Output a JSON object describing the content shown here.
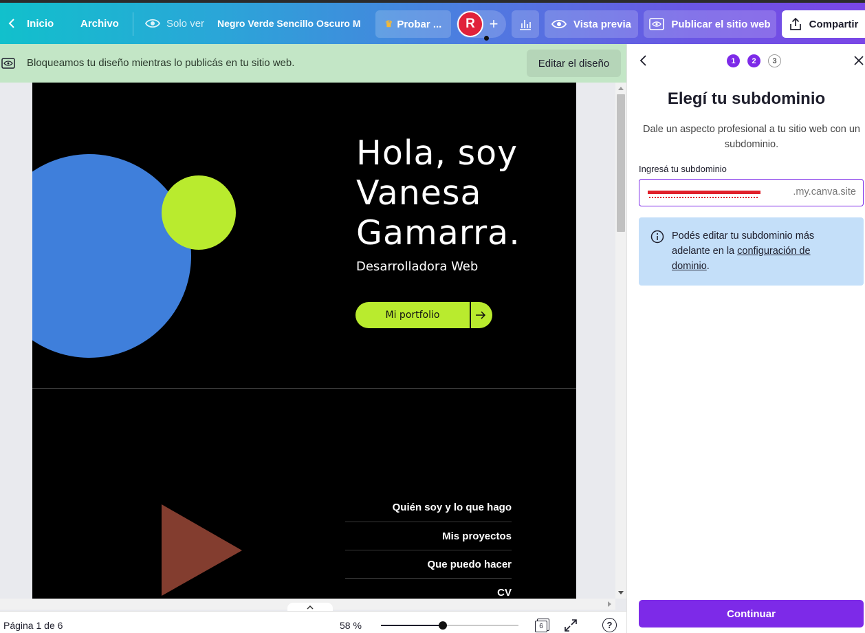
{
  "topbar": {
    "home_label": "Inicio",
    "file_label": "Archivo",
    "view_mode_label": "Solo ver",
    "doc_title": "Negro Verde Sencillo Oscuro M",
    "try_pro_label": "Probar ...",
    "avatar_initial": "R",
    "add_label": "+",
    "preview_label": "Vista previa",
    "publish_label": "Publicar el sitio web",
    "share_label": "Compartir"
  },
  "banner": {
    "message": "Bloqueamos tu diseño mientras lo publicás en tu sitio web.",
    "edit_button": "Editar el diseño"
  },
  "design": {
    "heading_line1": "Hola, soy",
    "heading_line2": "Vanesa",
    "heading_line3": "Gamarra.",
    "subtitle": "Desarrolladora Web",
    "portfolio_button": "Mi portfolio",
    "nav_items": [
      "Quién soy y lo que hago",
      "Mis proyectos",
      "Que puedo hacer",
      "CV"
    ],
    "colors": {
      "blue_circle": "#3f7fdb",
      "lime": "#b9eb2e",
      "triangle": "#833d2f"
    }
  },
  "panel": {
    "steps": [
      "1",
      "2",
      "3"
    ],
    "title": "Elegí tu subdominio",
    "description": "Dale un aspecto profesional a tu sitio web con un subdominio.",
    "input_label": "Ingresá tu subdominio",
    "input_suffix": ".my.canva.site",
    "info_text_before": "Podés editar tu subdominio más adelante en la ",
    "info_link": "configuración de dominio",
    "info_text_after": ".",
    "continue_button": "Continuar"
  },
  "bottombar": {
    "page_indicator": "Página 1 de 6",
    "zoom_label": "58 %",
    "zoom_value": 0.58,
    "pages_count": "6",
    "help_label": "?"
  },
  "colors": {
    "accent": "#7d2ae8",
    "banner_bg": "#c3e6c6",
    "info_bg": "#c4dff9"
  }
}
